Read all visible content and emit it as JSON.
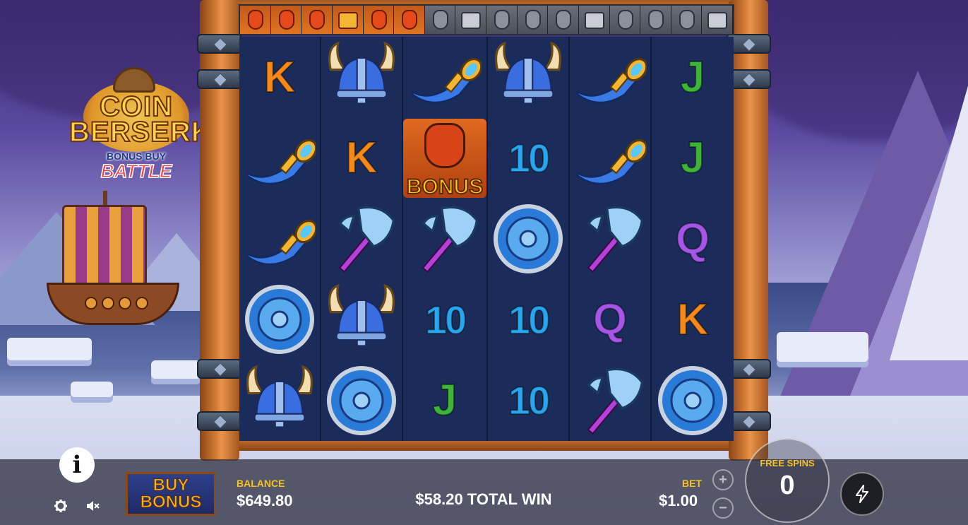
{
  "game": {
    "logo": {
      "line1": "COIN",
      "line2": "BERSERK",
      "line3": "BONUS BUY",
      "line4": "BATTLE"
    }
  },
  "meter": [
    {
      "type": "viking"
    },
    {
      "type": "viking"
    },
    {
      "type": "viking"
    },
    {
      "type": "viking-chest"
    },
    {
      "type": "viking"
    },
    {
      "type": "viking"
    },
    {
      "type": "grey"
    },
    {
      "type": "grey-chest"
    },
    {
      "type": "grey"
    },
    {
      "type": "grey"
    },
    {
      "type": "grey"
    },
    {
      "type": "grey-chest"
    },
    {
      "type": "grey"
    },
    {
      "type": "grey"
    },
    {
      "type": "grey"
    },
    {
      "type": "grey-chest"
    }
  ],
  "reels": [
    [
      "K",
      "horn",
      "horn",
      "shield",
      "helmet"
    ],
    [
      "helmet",
      "K",
      "axe",
      "helmet",
      "shield"
    ],
    [
      "horn",
      "bonus",
      "axe",
      "10",
      "J"
    ],
    [
      "helmet",
      "10",
      "shield",
      "10",
      "10"
    ],
    [
      "horn",
      "horn",
      "axe",
      "Q",
      "axe"
    ],
    [
      "J",
      "J",
      "Q",
      "K",
      "shield"
    ]
  ],
  "bonus_symbol_label": "BONUS",
  "footer": {
    "buy_bonus_line1": "BUY",
    "buy_bonus_line2": "BONUS",
    "balance_label": "BALANCE",
    "balance_value": "$649.80",
    "total_win": "$58.20 TOTAL WIN",
    "bet_label": "BET",
    "bet_value": "$1.00",
    "free_spins_label": "FREE SPINS",
    "free_spins_value": "0",
    "plus": "+",
    "minus": "−",
    "info": "i"
  },
  "icons": {
    "info": "info-icon",
    "settings": "gear-icon",
    "sound": "speaker-muted-icon",
    "turbo": "lightning-icon"
  },
  "colors": {
    "accent_yellow": "#f5c324",
    "reel_bg": "#1c2c5a",
    "wood": "#d27a34"
  }
}
